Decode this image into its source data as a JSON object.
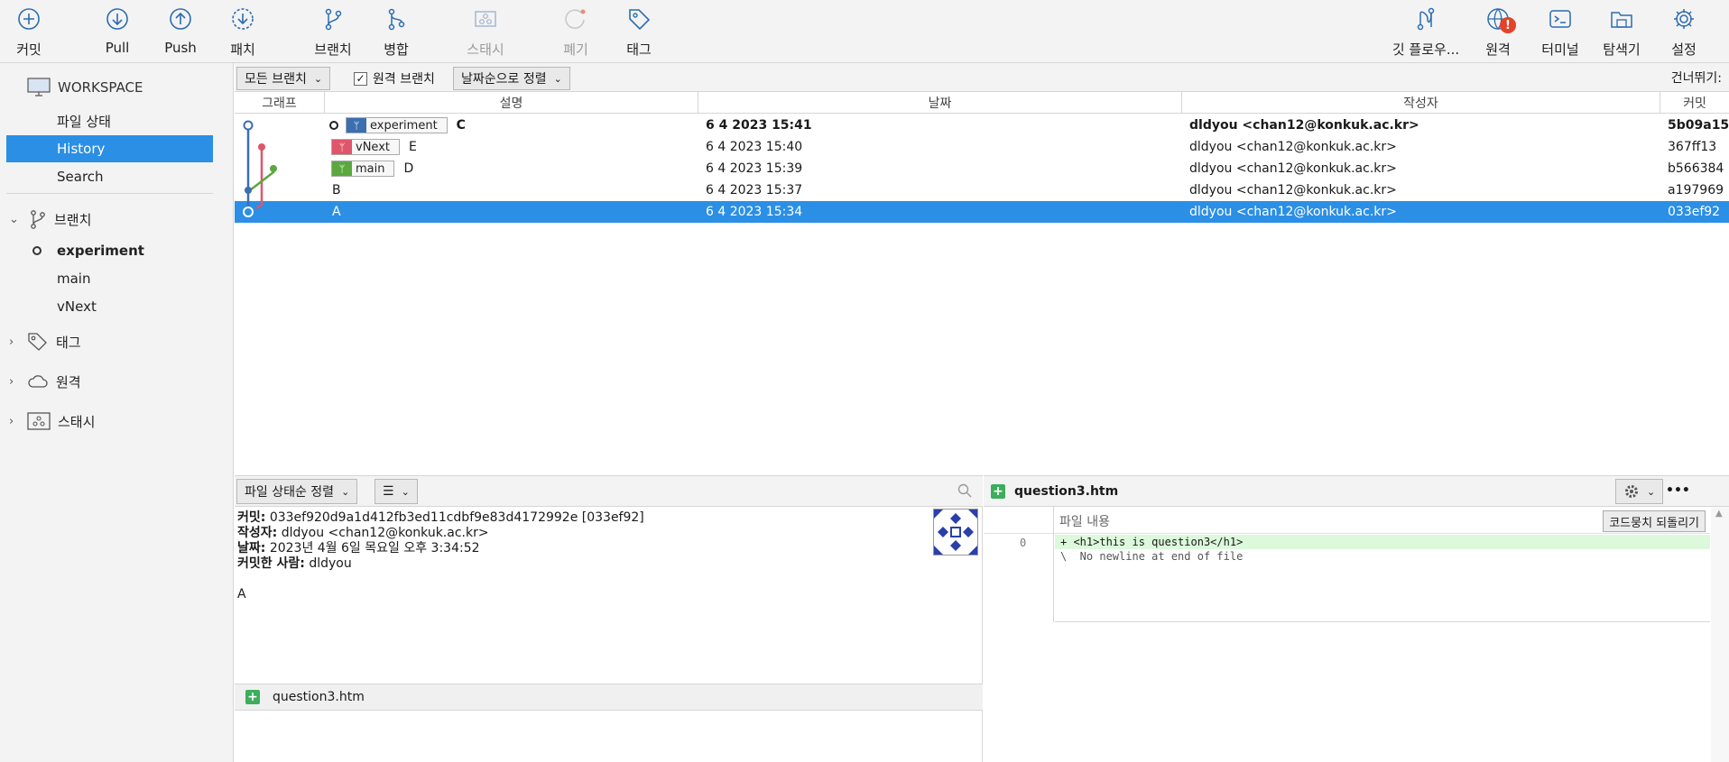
{
  "toolbar": {
    "commit": "커밋",
    "pull": "Pull",
    "push": "Push",
    "patch": "패치",
    "branch": "브랜치",
    "merge": "병합",
    "stash": "스태시",
    "discard": "폐기",
    "tag": "태그",
    "git_flow": "깃 플로우...",
    "remote": "원격",
    "terminal": "터미널",
    "explorer": "탐색기",
    "settings": "설정",
    "remote_badge": "!"
  },
  "sidebar": {
    "workspace": "WORKSPACE",
    "file_status": "파일 상태",
    "history": "History",
    "search": "Search",
    "branches_header": "브랜치",
    "branches": [
      "experiment",
      "main",
      "vNext"
    ],
    "tags_header": "태그",
    "remotes_header": "원격",
    "stash_header": "스태시"
  },
  "list_bar": {
    "all_branches": "모든 브랜치",
    "remote_branches": "원격 브랜치",
    "remote_checked": "✓",
    "sort_by_date": "날짜순으로 정렬",
    "skip": "건너뛰기:"
  },
  "columns": {
    "graph": "그래프",
    "description": "설명",
    "date": "날짜",
    "author": "작성자",
    "commit": "커밋"
  },
  "commits": [
    {
      "tag": "experiment",
      "msg": "C",
      "date": "6 4 2023 15:41",
      "author": "dldyou <chan12@konkuk.ac.kr>",
      "hash": "5b09a15"
    },
    {
      "tag": "vNext",
      "msg": "E",
      "date": "6 4 2023 15:40",
      "author": "dldyou <chan12@konkuk.ac.kr>",
      "hash": "367ff13"
    },
    {
      "tag": "main",
      "msg": "D",
      "date": "6 4 2023 15:39",
      "author": "dldyou <chan12@konkuk.ac.kr>",
      "hash": "b566384"
    },
    {
      "tag": "",
      "msg": "B",
      "date": "6 4 2023 15:37",
      "author": "dldyou <chan12@konkuk.ac.kr>",
      "hash": "a197969"
    },
    {
      "tag": "",
      "msg": "A",
      "date": "6 4 2023 15:34",
      "author": "dldyou <chan12@konkuk.ac.kr>",
      "hash": "033ef92"
    }
  ],
  "detail": {
    "sort_label": "파일 상태순 정렬",
    "view_icon": "☰",
    "commit_label": "커밋:",
    "commit_value": "033ef920d9a1d412fb3ed11cdbf9e83d4172992e [033ef92]",
    "author_label": "작성자:",
    "author_value": "dldyou <chan12@konkuk.ac.kr>",
    "date_label": "날짜:",
    "date_value": "2023년 4월 6일 목요일 오후 3:34:52",
    "committer_label": "커밋한 사람:",
    "committer_value": "dldyou",
    "message": "A",
    "file_name": "question3.htm"
  },
  "diff": {
    "file_name": "question3.htm",
    "header": "파일 내용",
    "revert": "코드뭉치 되돌리기",
    "line_no": "0",
    "line1": "+ <h1>this is question3</h1>",
    "line2": "\\  No newline at end of file",
    "more": "•••"
  },
  "colors": {
    "accent": "#2b8fe5",
    "experiment": "#3b6fb0",
    "vNext": "#e0556a",
    "main": "#5aa83e"
  }
}
